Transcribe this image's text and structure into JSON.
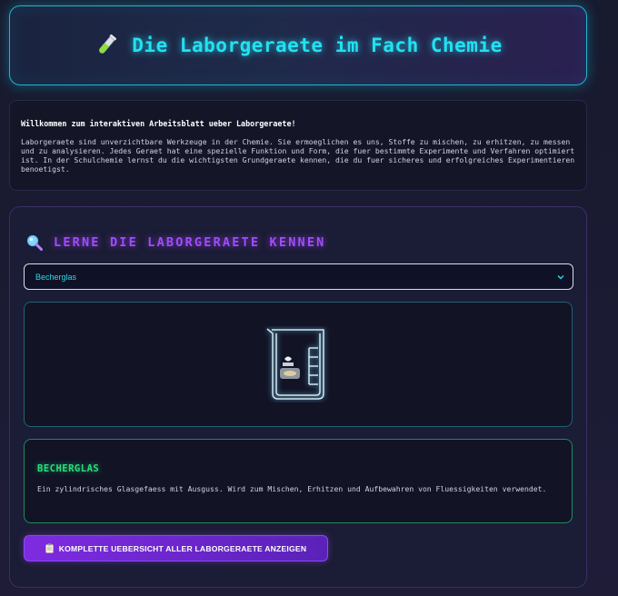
{
  "header": {
    "title": "Die Laborgeraete im Fach Chemie",
    "icon": "test-tube-icon"
  },
  "intro": {
    "lead": "Willkommen zum interaktiven Arbeitsblatt ueber Laborgeraete!",
    "body": "Laborgeraete sind unverzichtbare Werkzeuge in der Chemie. Sie ermoeglichen es uns, Stoffe zu mischen, zu erhitzen, zu messen und zu analysieren. Jedes Geraet hat eine spezielle Funktion und Form, die fuer bestimmte Experimente und Verfahren optimiert ist. In der Schulchemie lernst du die wichtigsten Grundgeraete kennen, die du fuer sicheres und erfolgreiches Experimentieren benoetigst."
  },
  "learn": {
    "title": "LERNE DIE LABORGERAETE KENNEN",
    "icon": "magnifier-icon",
    "select": {
      "selected": "Becherglas"
    },
    "equipment_icon": "beaker-icon",
    "info": {
      "name": "BECHERGLAS",
      "description": "Ein zylindrisches Glasgefaess mit Ausguss. Wird zum Mischen, Erhitzen und Aufbewahren von Fluessigkeiten verwendet."
    },
    "overview_button": {
      "icon": "clipboard-icon",
      "label": "KOMPLETTE UEBERSICHT ALLER LABORGERAETE ANZEIGEN"
    }
  },
  "colors": {
    "accent_cyan": "#23e1f2",
    "accent_purple": "#a34bff",
    "accent_green": "#28e07a",
    "button_purple": "#7e2be0"
  }
}
